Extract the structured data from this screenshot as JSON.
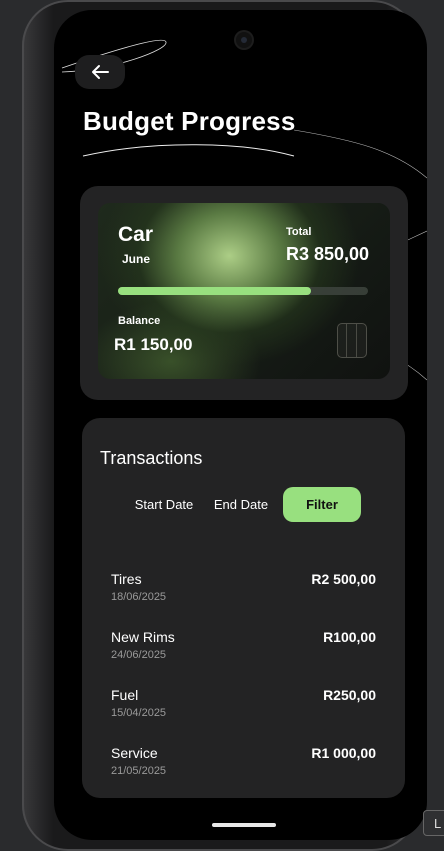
{
  "header": {
    "back_icon": "arrow-left-icon",
    "title": "Budget Progress"
  },
  "budget_card": {
    "name": "Car",
    "month": "June",
    "total_label": "Total",
    "total_value": "R3 850,00",
    "progress_fraction": 0.77,
    "balance_label": "Balance",
    "balance_value": "R1 150,00",
    "accent_color": "#98e07f"
  },
  "transactions": {
    "title": "Transactions",
    "start_date_label": "Start Date",
    "end_date_label": "End Date",
    "filter_label": "Filter",
    "items": [
      {
        "name": "Tires",
        "date": "18/06/2025",
        "amount": "R2 500,00"
      },
      {
        "name": "New Rims",
        "date": "24/06/2025",
        "amount": "R100,00"
      },
      {
        "name": "Fuel",
        "date": "15/04/2025",
        "amount": "R250,00"
      },
      {
        "name": "Service",
        "date": "21/05/2025",
        "amount": "R1 000,00"
      }
    ]
  },
  "corner_tag": "L"
}
